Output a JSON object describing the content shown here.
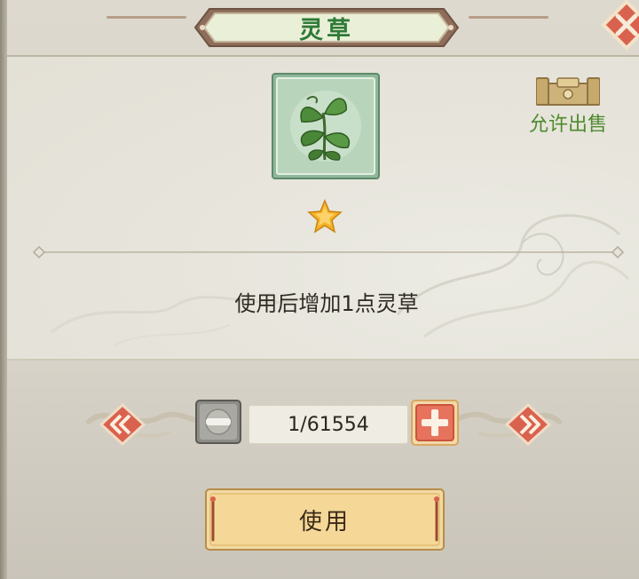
{
  "title": "灵草",
  "item": {
    "icon": "herb-plant-icon",
    "star_count": 1
  },
  "description": "使用后增加1点灵草",
  "sell_status": {
    "label": "允许出售",
    "icon": "sell-stamp-icon"
  },
  "quantity": {
    "display": "1/61554"
  },
  "buttons": {
    "use_label": "使用",
    "prev_icon": "double-chevron-left-icon",
    "next_icon": "double-chevron-right-icon",
    "minus_icon": "minus-icon",
    "plus_icon": "plus-icon",
    "close_icon": "close-icon"
  },
  "colors": {
    "title_green": "#2f7a38",
    "sell_green": "#4f8a2e",
    "accent_red": "#d9624e",
    "button_gold": "#f1d9a2"
  }
}
